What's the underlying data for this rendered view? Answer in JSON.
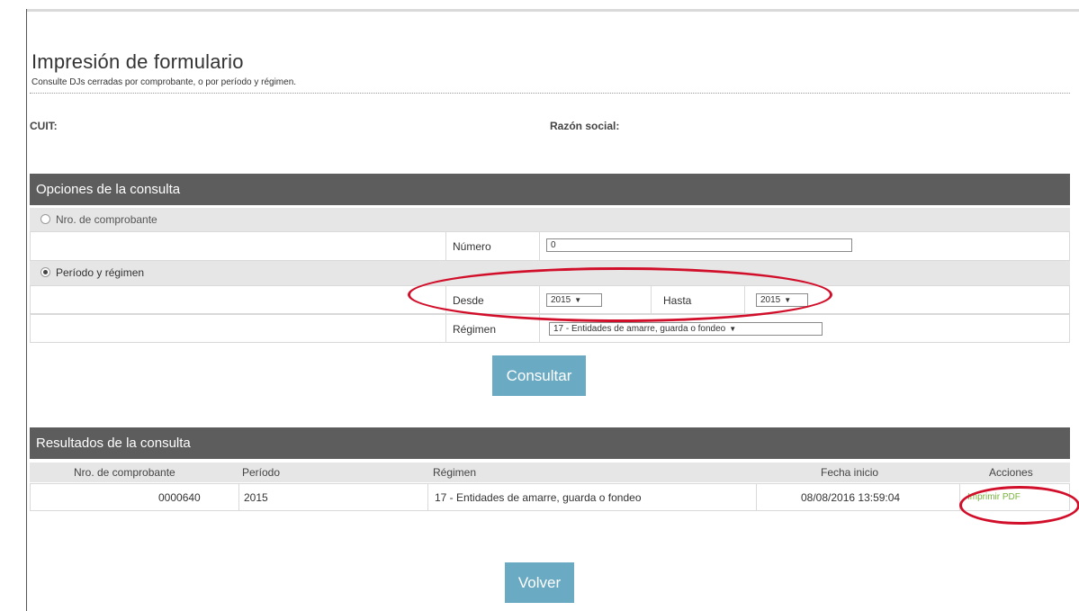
{
  "header": {
    "title": "Impresión de formulario",
    "subtitle": "Consulte DJs cerradas por comprobante, o por período y régimen."
  },
  "taxpayer": {
    "cuit_label": "CUIT:",
    "razon_social_label": "Razón social:"
  },
  "options": {
    "title": "Opciones de la consulta",
    "by_comprobante": {
      "label": "Nro. de comprobante",
      "selected": false
    },
    "numero": {
      "label": "Número",
      "value": "0"
    },
    "by_periodo": {
      "label": "Período y régimen",
      "selected": true
    },
    "desde": {
      "label": "Desde",
      "value": "2015"
    },
    "hasta": {
      "label": "Hasta",
      "value": "2015"
    },
    "regimen": {
      "label": "Régimen",
      "value": "17 - Entidades de amarre, guarda o fondeo"
    },
    "consultar_label": "Consultar"
  },
  "results": {
    "title": "Resultados de la consulta",
    "columns": [
      "Nro. de comprobante",
      "Período",
      "Régimen",
      "Fecha inicio",
      "Acciones"
    ],
    "rows": [
      {
        "comprobante": "0000640",
        "periodo": "2015",
        "regimen": "17 - Entidades de amarre, guarda o fondeo",
        "fecha_inicio": "08/08/2016 13:59:04",
        "accion": "Imprimir PDF"
      }
    ]
  },
  "footer": {
    "volver_label": "Volver"
  },
  "colors": {
    "section_header": "#5d5d5d",
    "row_gray": "#e6e6e6",
    "button": "#6aaac3",
    "link_green": "#7ab33e",
    "annotation_red": "#d20f2a"
  }
}
